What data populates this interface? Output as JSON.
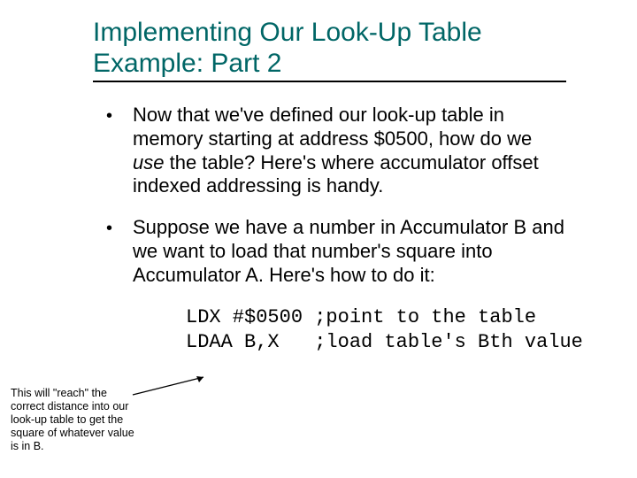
{
  "title": {
    "line1": "Implementing Our Look-Up Table",
    "line2": "Example: Part 2"
  },
  "bullets": [
    {
      "dot": "•",
      "pre": "Now that we've defined our look-up table in memory starting at address $0500, how do we ",
      "italic": "use",
      "post": " the table?  Here's where accumulator offset indexed addressing is handy."
    },
    {
      "dot": "•",
      "pre": "Suppose we have a number in Accumulator B and we want to load that number's square into Accumulator A.  Here's how to do it:",
      "italic": "",
      "post": ""
    }
  ],
  "code": {
    "line1": "LDX #$0500 ;point to the table",
    "line2": "LDAA B,X   ;load table's Bth value"
  },
  "annotation": "This will \"reach\" the correct distance into our look-up table to get the square of whatever value is in B."
}
